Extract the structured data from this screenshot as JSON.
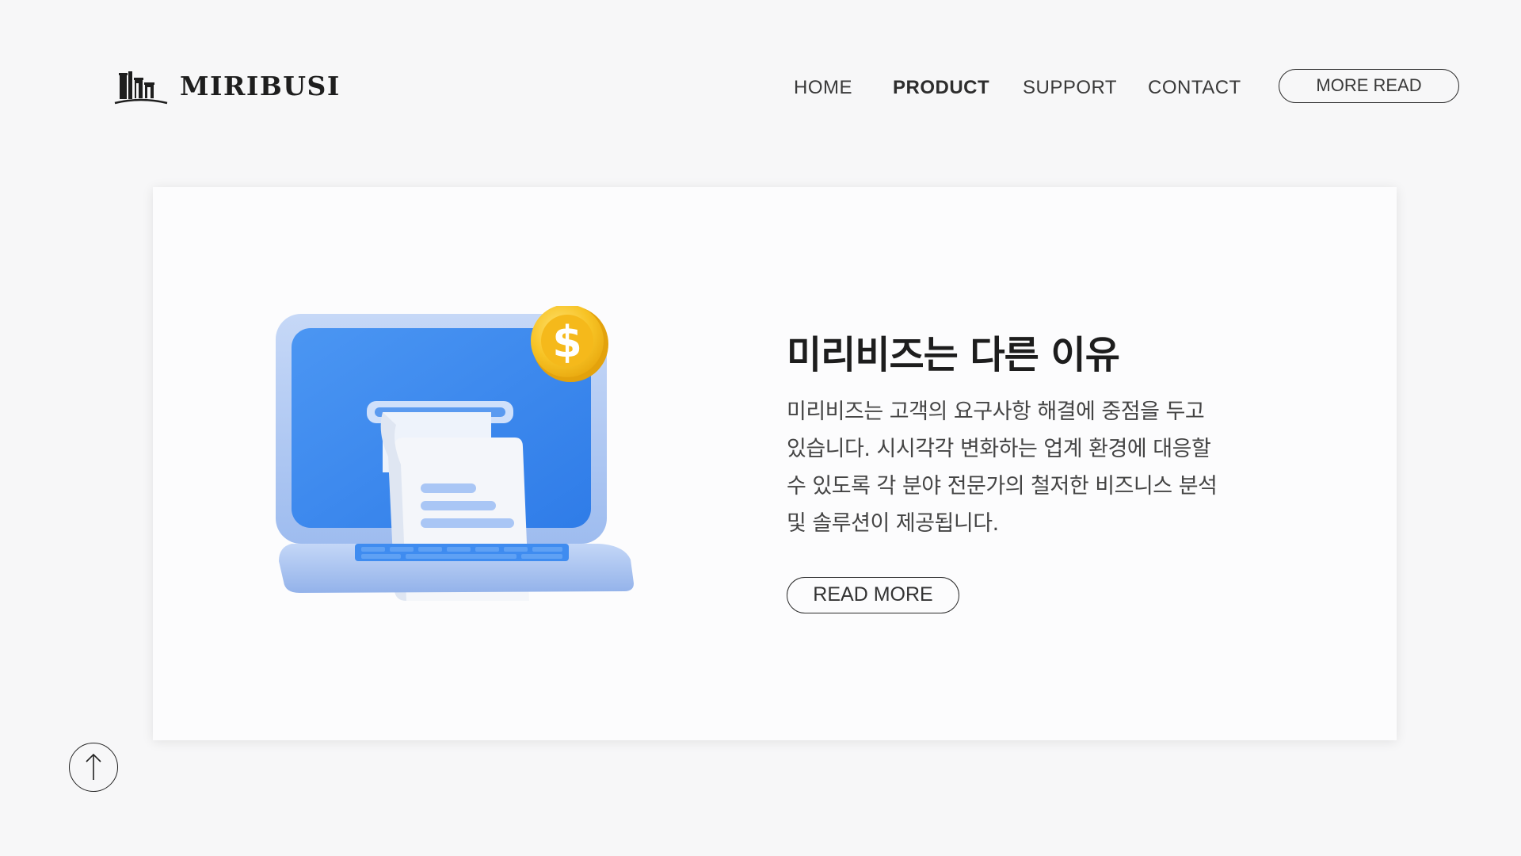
{
  "brand": {
    "name": "MIRIBUSI"
  },
  "nav": {
    "items": [
      {
        "label": "HOME",
        "active": false
      },
      {
        "label": "PRODUCT",
        "active": true
      },
      {
        "label": "SUPPORT",
        "active": false
      },
      {
        "label": "CONTACT",
        "active": false
      }
    ],
    "cta_label": "MORE READ"
  },
  "feature": {
    "title": "미리비즈는 다른 이유",
    "description": "미리비즈는 고객의 요구사항 해결에 중점을 두고\n있습니다. 시시각각 변화하는 업계 환경에 대응할\n수 있도록 각 분야 전문가의 철저한 비즈니스 분석\n및 솔루션이 제공됩니다.",
    "button_label": "READ MORE",
    "illustration": "laptop-with-receipt-and-dollar-coin",
    "coin_symbol": "$"
  },
  "colors": {
    "background": "#f7f7f8",
    "card": "#fcfcfd",
    "screen_blue": "#3f8cf0",
    "laptop_frame": "#a9c4f2",
    "coin_gold": "#f7c325",
    "text_dark": "#1d1d1d"
  },
  "icons": {
    "scroll_top": "arrow-up-icon"
  }
}
